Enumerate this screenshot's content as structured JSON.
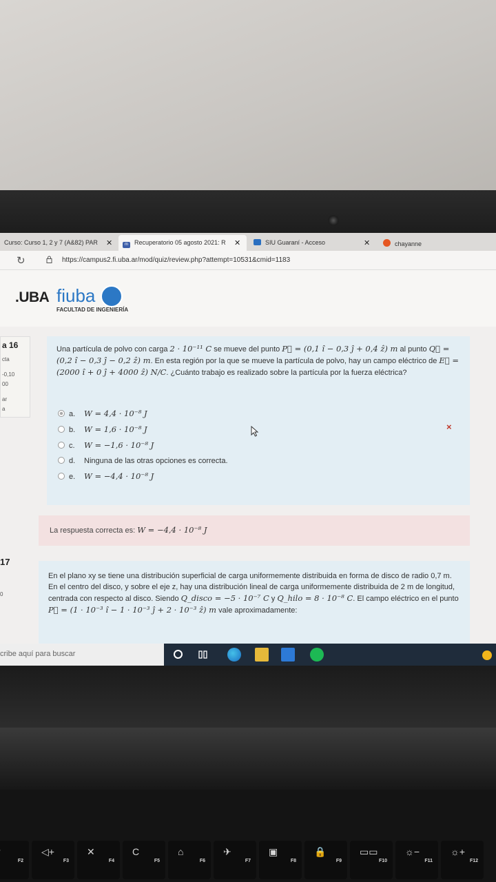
{
  "browser": {
    "tabs": [
      {
        "label": "Curso: Curso 1, 2 y 7 (A&82) PAR"
      },
      {
        "label": "Recuperatorio 05 agosto 2021: R"
      },
      {
        "label": "SIU Guaraní - Acceso"
      },
      {
        "label": "chayanne"
      }
    ],
    "url": "https://campus2.fi.uba.ar/mod/quiz/review.php?attempt=10531&cmid=1183"
  },
  "logo": {
    "uba": ".UBA",
    "fiuba": "fiuba",
    "subtitle": "FACULTAD DE INGENIERÍA"
  },
  "q16": {
    "side_number": "a 16",
    "side_lines": [
      "cta",
      "-0,10",
      "00",
      "ar",
      "a"
    ],
    "text_1": "Una partícula de polvo con carga ",
    "charge": "2 · 10⁻¹¹ C",
    "text_2": " se mueve del punto ",
    "P": "P⃗ = (0,1 î − 0,3 ĵ + 0,4 ẑ) m",
    "text_3": " al punto ",
    "Q": "Q⃗ = (0,2 î − 0,3 ĵ − 0,2 ẑ) m",
    "text_4": ". En esta región por la que se mueve la partícula de polvo, hay un campo eléctrico de ",
    "E": "E⃗ = (2000 î + 0 ĵ + 4000 ẑ) N/C",
    "text_5": ". ¿Cuánto trabajo es realizado sobre la partícula por la fuerza eléctrica?",
    "options": [
      {
        "letter": "a.",
        "text": "W = 4,4 · 10⁻⁸ J",
        "math": true
      },
      {
        "letter": "b.",
        "text": "W = 1,6 · 10⁻⁸ J",
        "math": true
      },
      {
        "letter": "c.",
        "text": "W = −1,6 · 10⁻⁸ J",
        "math": true
      },
      {
        "letter": "d.",
        "text": "Ninguna de las otras opciones es correcta.",
        "math": false
      },
      {
        "letter": "e.",
        "text": "W = −4,4 · 10⁻⁸ J",
        "math": true
      }
    ],
    "wrong_mark": "×",
    "answer_label": "La respuesta correcta es: ",
    "answer_value": "W = −4,4 · 10⁻⁸ J"
  },
  "q17": {
    "side_number": "17",
    "side_line": "0",
    "text_1": "En el plano xy se tiene una distribución superficial de carga uniformemente distribuida en forma de disco de radio 0,7 m. En el centro del disco, y sobre el eje z, hay una distribución lineal de carga uniformemente distribuida de 2 m de longitud, centrada con respecto al disco. Siendo ",
    "Qdisco": "Q_disco = −5 · 10⁻⁷ C",
    "text_2": " y ",
    "Qhilo": "Q_hilo = 8 · 10⁻⁸ C",
    "text_3": ". El campo eléctrico en el punto ",
    "P": "P⃗ = (1 · 10⁻³ î − 1 · 10⁻³ ĵ + 2 · 10⁻³ ẑ) m",
    "text_4": " vale aproximadamente:"
  },
  "taskbar": {
    "search_placeholder": "cribe aquí para buscar"
  },
  "keyboard": {
    "keys": [
      {
        "label": "F2",
        "symbol": "⁻"
      },
      {
        "label": "F3",
        "symbol": "◁+"
      },
      {
        "label": "F4",
        "symbol": "✕"
      },
      {
        "label": "F5",
        "symbol": "C"
      },
      {
        "label": "F6",
        "symbol": "⌂"
      },
      {
        "label": "F7",
        "symbol": "✈"
      },
      {
        "label": "F8",
        "symbol": "▣"
      },
      {
        "label": "F9",
        "symbol": "🔒"
      },
      {
        "label": "F10",
        "symbol": "▭▭"
      },
      {
        "label": "F11",
        "symbol": "☼−"
      },
      {
        "label": "F12",
        "symbol": "☼+"
      }
    ]
  }
}
